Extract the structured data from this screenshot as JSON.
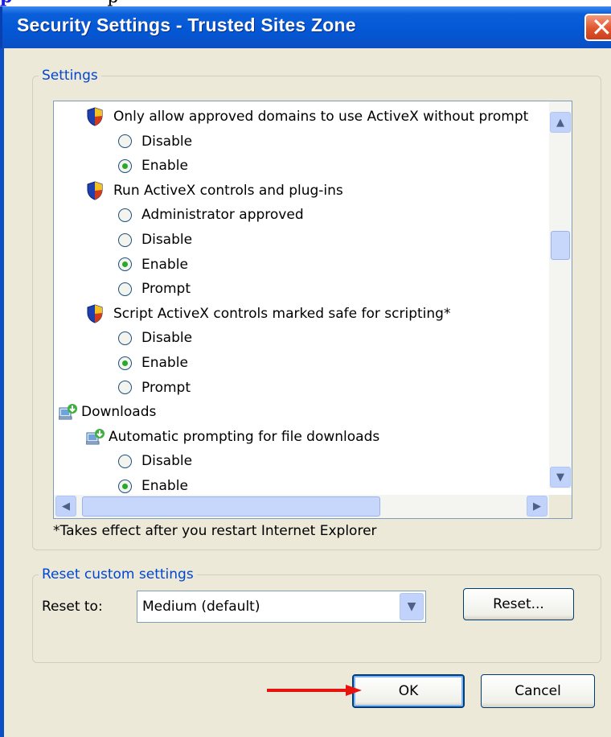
{
  "dialog": {
    "title": "Security Settings - Trusted Sites Zone"
  },
  "settings": {
    "group_label": "Settings",
    "rows": [
      {
        "kind": "item",
        "label": "Only allow approved domains to use ActiveX without prompt",
        "icon": "shield-icon"
      },
      {
        "kind": "option",
        "label": "Disable",
        "selected": false
      },
      {
        "kind": "option",
        "label": "Enable",
        "selected": true
      },
      {
        "kind": "item",
        "label": "Run ActiveX controls and plug-ins",
        "icon": "shield-icon"
      },
      {
        "kind": "option",
        "label": "Administrator approved",
        "selected": false
      },
      {
        "kind": "option",
        "label": "Disable",
        "selected": false
      },
      {
        "kind": "option",
        "label": "Enable",
        "selected": true
      },
      {
        "kind": "option",
        "label": "Prompt",
        "selected": false
      },
      {
        "kind": "item",
        "label": "Script ActiveX controls marked safe for scripting*",
        "icon": "shield-icon"
      },
      {
        "kind": "option",
        "label": "Disable",
        "selected": false
      },
      {
        "kind": "option",
        "label": "Enable",
        "selected": true
      },
      {
        "kind": "option",
        "label": "Prompt",
        "selected": false
      },
      {
        "kind": "category",
        "label": "Downloads",
        "icon": "download-icon"
      },
      {
        "kind": "subitem",
        "label": "Automatic prompting for file downloads",
        "icon": "download-icon"
      },
      {
        "kind": "option",
        "label": "Disable",
        "selected": false
      },
      {
        "kind": "option",
        "label": "Enable",
        "selected": true
      }
    ],
    "note": "*Takes effect after you restart Internet Explorer"
  },
  "reset": {
    "group_label": "Reset custom settings",
    "reset_to_label": "Reset to:",
    "selected_level": "Medium (default)",
    "reset_button": "Reset..."
  },
  "buttons": {
    "ok": "OK",
    "cancel": "Cancel"
  },
  "colors": {
    "titlebar": "#0457d4",
    "legend_text": "#0046d5",
    "annotation_arrow": "#e8130c"
  }
}
